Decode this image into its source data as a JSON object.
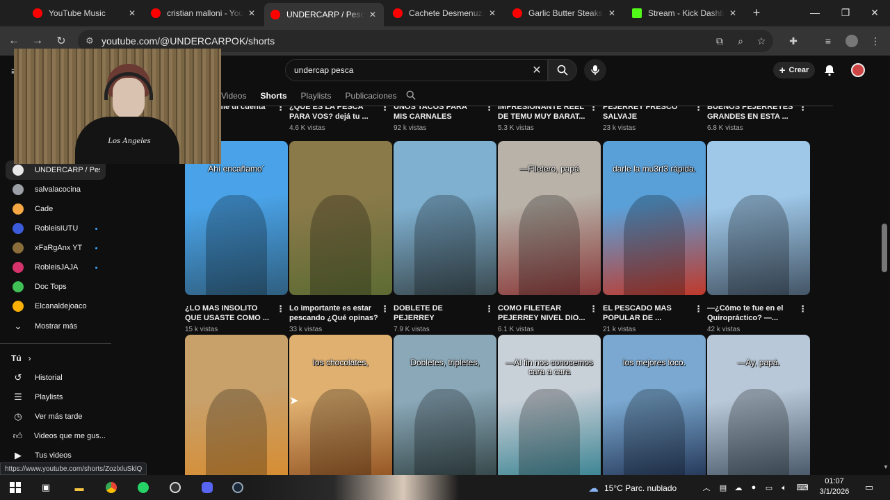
{
  "browser": {
    "tabs": [
      {
        "title": "YouTube Music",
        "favicon": "youtube-music-icon",
        "color": "#ff0000"
      },
      {
        "title": "cristian malloni - YouTube",
        "favicon": "youtube-icon",
        "color": "#ff0000"
      },
      {
        "title": "UNDERCARP / Pesca",
        "favicon": "youtube-icon",
        "color": "#ff0000"
      },
      {
        "title": "Cachete Desmenuzado",
        "favicon": "youtube-icon",
        "color": "#ff0000"
      },
      {
        "title": "Garlic Butter Steaks and",
        "favicon": "youtube-icon",
        "color": "#ff0000"
      },
      {
        "title": "Stream - Kick Dashboard",
        "favicon": "kick-icon",
        "color": "#53fc18"
      }
    ],
    "url": "youtube.com/@UNDERCARPOK/shorts"
  },
  "youtube": {
    "search_query": "undercap pesca",
    "create_label": "Crear",
    "channel_tabs": [
      "Videos",
      "Shorts",
      "Playlists",
      "Publicaciones"
    ],
    "active_tab": "Shorts",
    "sidebar": {
      "subscriptions": [
        {
          "name": "UNDERCARP / Pes...",
          "color": "#e8e8e8",
          "selected": true,
          "live": false
        },
        {
          "name": "salvalacocina",
          "color": "#9aa0a6",
          "selected": false,
          "live": false
        },
        {
          "name": "Cade",
          "color": "#f4a742",
          "selected": false,
          "live": false
        },
        {
          "name": "RobleisIUTU",
          "color": "#3b5bdb",
          "selected": false,
          "live": true
        },
        {
          "name": "xFaRgAnx YT",
          "color": "#8a6d3b",
          "selected": false,
          "live": true
        },
        {
          "name": "RobleisJAJA",
          "color": "#d6336c",
          "selected": false,
          "live": true
        },
        {
          "name": "Doc Tops",
          "color": "#40c057",
          "selected": false,
          "live": false
        },
        {
          "name": "Elcanaldejoaco",
          "color": "#fab005",
          "selected": false,
          "live": false
        }
      ],
      "show_more": "Mostrar más",
      "you_label": "Tú",
      "you_items": [
        {
          "label": "Historial",
          "icon": "history-icon"
        },
        {
          "label": "Playlists",
          "icon": "playlists-icon"
        },
        {
          "label": "Ver más tarde",
          "icon": "watch-later-icon"
        },
        {
          "label": "Videos que me gus...",
          "icon": "like-icon"
        },
        {
          "label": "Tus videos",
          "icon": "your-videos-icon"
        }
      ]
    },
    "shorts_row_top": [
      {
        "title": "...ocuito, me di cuenta de... ...",
        "views": "...vistas"
      },
      {
        "title": "¿QUE ES LA PESCA PARA VOS? dejá tu ...",
        "views": "4.6 K vistas"
      },
      {
        "title": "UNOS TACOS PARA MIS CARNALES",
        "views": "92 k vistas"
      },
      {
        "title": "IMPRESIONANTE REEL DE TEMU MUY BARAT...",
        "views": "5.3 K vistas"
      },
      {
        "title": "PEJERREY FRESCO SALVAJE",
        "views": "23 k vistas"
      },
      {
        "title": "BUENOS PEJERREYES GRANDES EN ESTA ...",
        "views": "6.8 K vistas"
      }
    ],
    "shorts_row_mid": [
      {
        "caption": "Ahí encañamo´",
        "title": "¿LO MAS INSOLITO QUE USASTE COMO ...",
        "views": "15 k vistas",
        "c1": "#4aa3e8",
        "c2": "#2f5f80"
      },
      {
        "caption": "",
        "title": "Lo importante es estar pescando ¿Qué opinas?",
        "views": "33 k vistas",
        "c1": "#8a7a4a",
        "c2": "#5d6b33"
      },
      {
        "caption": "",
        "title": "DOBLETE DE PEJERREY ENCAÑANDO COMO ...",
        "views": "7.9 K vistas",
        "c1": "#7fb0d0",
        "c2": "#3a4a50"
      },
      {
        "caption": "—Filetero, papá",
        "title": "COMO FILETEAR PEJERREY NIVEL DIO...",
        "views": "6.1 K vistas",
        "c1": "#b8b2a8",
        "c2": "#8a3a3a"
      },
      {
        "caption": "darle la mu3rt3 rápida.",
        "title": "EL PESCADO MAS POPULAR DE ...",
        "views": "21 k vistas",
        "c1": "#5aa0d8",
        "c2": "#c0392b"
      },
      {
        "caption": "",
        "title": "—¿Cómo te fue en el Quiropráctico? —...",
        "views": "42 k vistas",
        "c1": "#9ec7e8",
        "c2": "#445566"
      }
    ],
    "shorts_row_bottom": [
      {
        "caption": "",
        "c1": "#c8a06a",
        "c2": "#d98a2a"
      },
      {
        "caption": "los chocolates,",
        "c1": "#e0b070",
        "c2": "#8a4a1a"
      },
      {
        "caption": "Dobletes, tripletes,",
        "c1": "#8aa8b8",
        "c2": "#2a3a3a"
      },
      {
        "caption": "—Al fin nos conocemos cara a cara",
        "c1": "#c8d0d8",
        "c2": "#2a7a8a"
      },
      {
        "caption": "los mejores loco.",
        "c1": "#7aa8d0",
        "c2": "#1a2a4a"
      },
      {
        "caption": "—Ay, papá.",
        "c1": "#b8c8d8",
        "c2": "#3a4a5a"
      }
    ],
    "status_url": "https://www.youtube.com/shorts/ZozlxluSklQ"
  },
  "webcam": {
    "shirt_text": "Los Angeles"
  },
  "taskbar": {
    "weather": "15°C  Parc. nublado",
    "time": "01:07",
    "date": "3/1/2026"
  }
}
